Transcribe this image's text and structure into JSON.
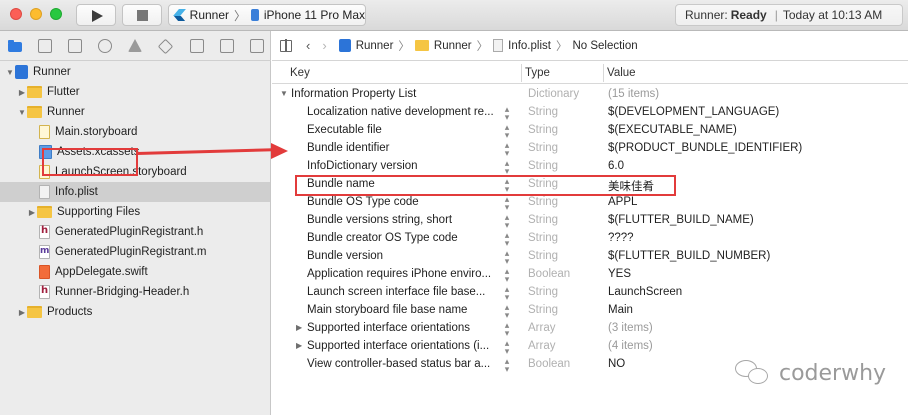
{
  "toolbar": {
    "scheme": "Runner",
    "device": "iPhone 11 Pro Max",
    "status_prefix": "Runner:",
    "status_state": "Ready",
    "status_time": "Today at 10:13 AM"
  },
  "navigator": {
    "items": [
      {
        "label": "Runner",
        "icon": "project-icon"
      },
      {
        "label": "Flutter",
        "icon": "folder-icon"
      },
      {
        "label": "Runner",
        "icon": "folder-icon"
      },
      {
        "label": "Main.storyboard",
        "icon": "storyboard-icon"
      },
      {
        "label": "Assets.xcassets",
        "icon": "assets-icon"
      },
      {
        "label": "LaunchScreen.storyboard",
        "icon": "storyboard-icon"
      },
      {
        "label": "Info.plist",
        "icon": "plist-icon",
        "selected": true
      },
      {
        "label": "Supporting Files",
        "icon": "folder-icon"
      },
      {
        "label": "GeneratedPluginRegistrant.h",
        "icon": "header-file-icon"
      },
      {
        "label": "GeneratedPluginRegistrant.m",
        "icon": "objc-file-icon"
      },
      {
        "label": "AppDelegate.swift",
        "icon": "swift-file-icon"
      },
      {
        "label": "Runner-Bridging-Header.h",
        "icon": "header-file-icon"
      },
      {
        "label": "Products",
        "icon": "folder-icon"
      }
    ]
  },
  "jumpbar": {
    "crumbs": [
      "Runner",
      "Runner",
      "Info.plist",
      "No Selection"
    ]
  },
  "plist": {
    "headers": {
      "key": "Key",
      "type": "Type",
      "value": "Value"
    },
    "rows": [
      {
        "key": "Information Property List",
        "type": "Dictionary",
        "value": "(15 items)"
      },
      {
        "key": "Localization native development re...",
        "type": "String",
        "value": "$(DEVELOPMENT_LANGUAGE)"
      },
      {
        "key": "Executable file",
        "type": "String",
        "value": "$(EXECUTABLE_NAME)"
      },
      {
        "key": "Bundle identifier",
        "type": "String",
        "value": "$(PRODUCT_BUNDLE_IDENTIFIER)"
      },
      {
        "key": "InfoDictionary version",
        "type": "String",
        "value": "6.0"
      },
      {
        "key": "Bundle name",
        "type": "String",
        "value": "美味佳肴"
      },
      {
        "key": "Bundle OS Type code",
        "type": "String",
        "value": "APPL"
      },
      {
        "key": "Bundle versions string, short",
        "type": "String",
        "value": "$(FLUTTER_BUILD_NAME)"
      },
      {
        "key": "Bundle creator OS Type code",
        "type": "String",
        "value": "????"
      },
      {
        "key": "Bundle version",
        "type": "String",
        "value": "$(FLUTTER_BUILD_NUMBER)"
      },
      {
        "key": "Application requires iPhone enviro...",
        "type": "Boolean",
        "value": "YES"
      },
      {
        "key": "Launch screen interface file base...",
        "type": "String",
        "value": "LaunchScreen"
      },
      {
        "key": "Main storyboard file base name",
        "type": "String",
        "value": "Main"
      },
      {
        "key": "Supported interface orientations",
        "type": "Array",
        "value": "(3 items)"
      },
      {
        "key": "Supported interface orientations (i...",
        "type": "Array",
        "value": "(4 items)"
      },
      {
        "key": "View controller-based status bar a...",
        "type": "Boolean",
        "value": "NO"
      }
    ]
  },
  "watermark": "coderwhy",
  "colors": {
    "highlight": "#e23b3b",
    "selection": "#cfcfcf",
    "folder": "#f5c543"
  }
}
